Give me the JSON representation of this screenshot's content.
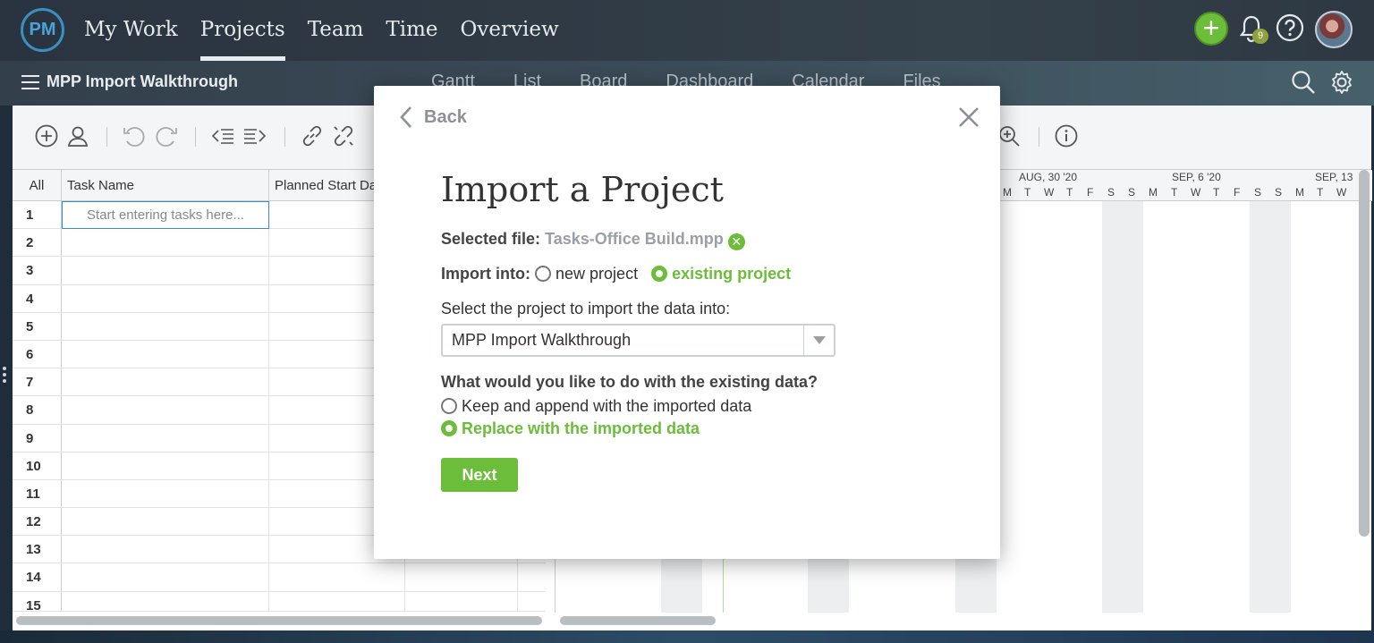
{
  "topnav": {
    "logo": "PM",
    "items": [
      "My Work",
      "Projects",
      "Team",
      "Time",
      "Overview"
    ],
    "active": "Projects",
    "notification_count": "9"
  },
  "subbar": {
    "project_title": "MPP Import Walkthrough",
    "tabs": [
      "Gantt",
      "List",
      "Board",
      "Dashboard",
      "Calendar",
      "Files"
    ]
  },
  "grid": {
    "headers": [
      "All",
      "Task Name",
      "Planned Start Da"
    ],
    "placeholder": "Start entering tasks here...",
    "rows": [
      "1",
      "2",
      "3",
      "4",
      "5",
      "6",
      "7",
      "8",
      "9",
      "10",
      "11",
      "12",
      "13",
      "14",
      "15"
    ]
  },
  "gantt": {
    "weeks": [
      "AUG, 30 '20",
      "SEP, 6 '20",
      "SEP, 13"
    ],
    "days": [
      "M",
      "T",
      "W",
      "T",
      "F",
      "S",
      "S",
      "M",
      "T",
      "W",
      "T",
      "F",
      "S",
      "S",
      "M",
      "T",
      "W"
    ]
  },
  "modal": {
    "back_label": "Back",
    "title": "Import a Project",
    "selected_file_label": "Selected file:",
    "selected_file": "Tasks-Office Build.mpp",
    "import_into_label": "Import into:",
    "option_new": "new project",
    "option_existing": "existing project",
    "select_prompt": "Select the project to import the data into:",
    "selected_project": "MPP Import Walkthrough",
    "existing_data_question": "What would you like to do with the existing data?",
    "option_keep": "Keep and append with the imported data",
    "option_replace": "Replace with the imported data",
    "next_label": "Next"
  },
  "colors": {
    "accent_green": "#6bbd3a",
    "link_blue": "#3a8fc0"
  }
}
